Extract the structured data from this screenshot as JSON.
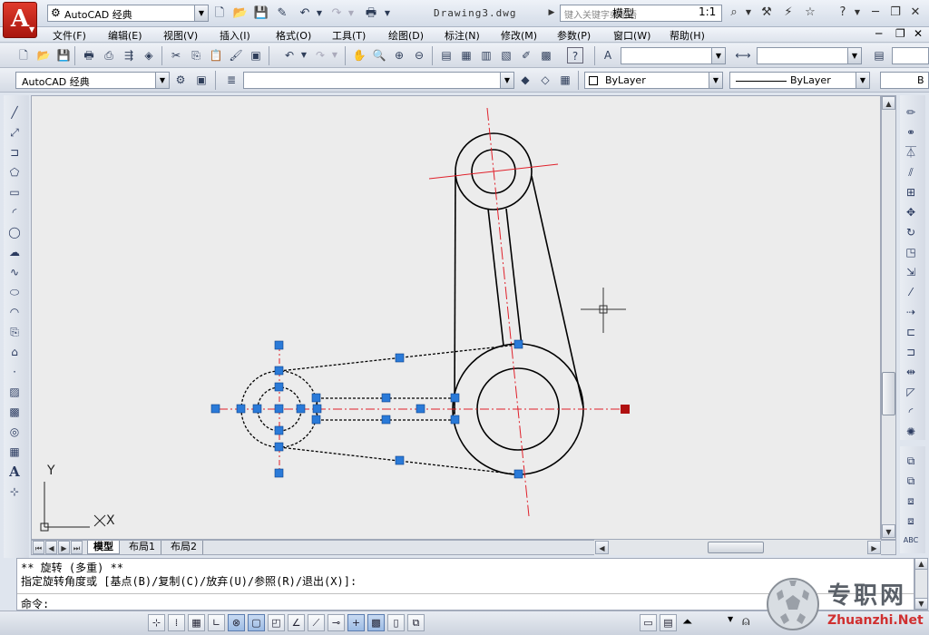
{
  "titlebar": {
    "logo_letter": "A",
    "workspace": "AutoCAD 经典",
    "doc_title": "Drawing3.dwg",
    "search_placeholder": "键入关键字或短语"
  },
  "menu": [
    "文件(F)",
    "编辑(E)",
    "视图(V)",
    "插入(I)",
    "格式(O)",
    "工具(T)",
    "绘图(D)",
    "标注(N)",
    "修改(M)",
    "参数(P)",
    "窗口(W)",
    "帮助(H)"
  ],
  "toolbar": {
    "workspace_combo": "AutoCAD 经典",
    "color_combo": "ByLayer",
    "linetype_combo": "ByLayer",
    "lineweight_combo": "B"
  },
  "tabs": [
    "模型",
    "布局1",
    "布局2"
  ],
  "ucs": {
    "x": "X",
    "y": "Y"
  },
  "command": {
    "line1": "** 旋转 (多重) **",
    "line2": "指定旋转角度或 [基点(B)/复制(C)/放弃(U)/参照(R)/退出(X)]:",
    "prompt": "命令:"
  },
  "status": {
    "model_label": "模型",
    "scale_label": "1:1"
  },
  "watermark": {
    "cn": "专职网",
    "en": "Zhuanzhi.Net"
  },
  "colors": {
    "centerline": "#e0202a",
    "grip": "#2a7ad8",
    "hot_grip": "#b01010",
    "canvas": "#ececec"
  }
}
